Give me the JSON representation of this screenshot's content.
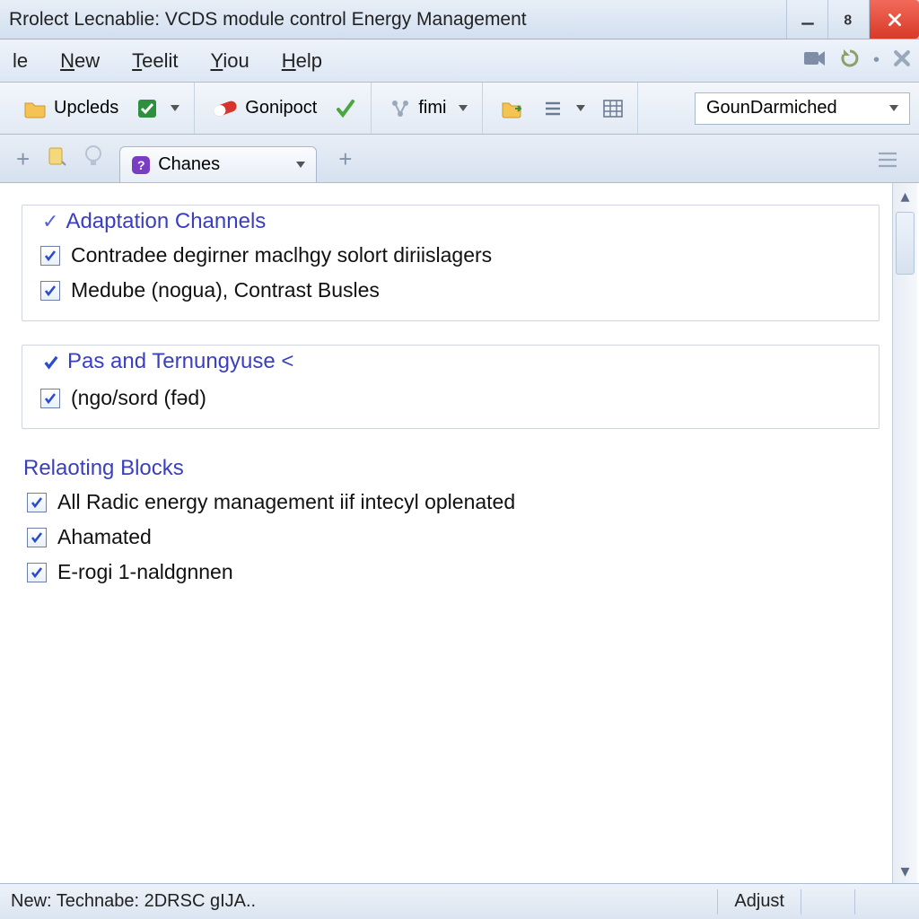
{
  "window": {
    "title": "Rrolect Lecnablie: VCDS module control Energy Management"
  },
  "menu": {
    "items": [
      "le",
      "New",
      "Teelit",
      "Yiou",
      "Help"
    ]
  },
  "toolbar": {
    "upcleds": "Upcleds",
    "gonipoct": "Gonipoct",
    "fimi": "fimi",
    "dropdown": "GounDarmiched"
  },
  "tab": {
    "label": "Chanes"
  },
  "groups": [
    {
      "title": "Adaptation Channels",
      "leadIcon": "check",
      "items": [
        "Contradee degirner maclhgy solort diriislagers",
        "Medube (nogua), Contrast Busles"
      ]
    },
    {
      "title": "Pas and Ternungyuse <",
      "leadIcon": "checkbox",
      "items": [
        "(ngo/sord (fəd)"
      ]
    },
    {
      "title": "Relaoting Blocks",
      "leadIcon": "none",
      "items": [
        "All Radic energy management iif intecyl oplenated",
        "Ahamated",
        "E-rogi 1-naldgnnen"
      ]
    }
  ],
  "status": {
    "left": "New: Technabe: 2DRSC gIJA..",
    "right": "Adjust"
  }
}
